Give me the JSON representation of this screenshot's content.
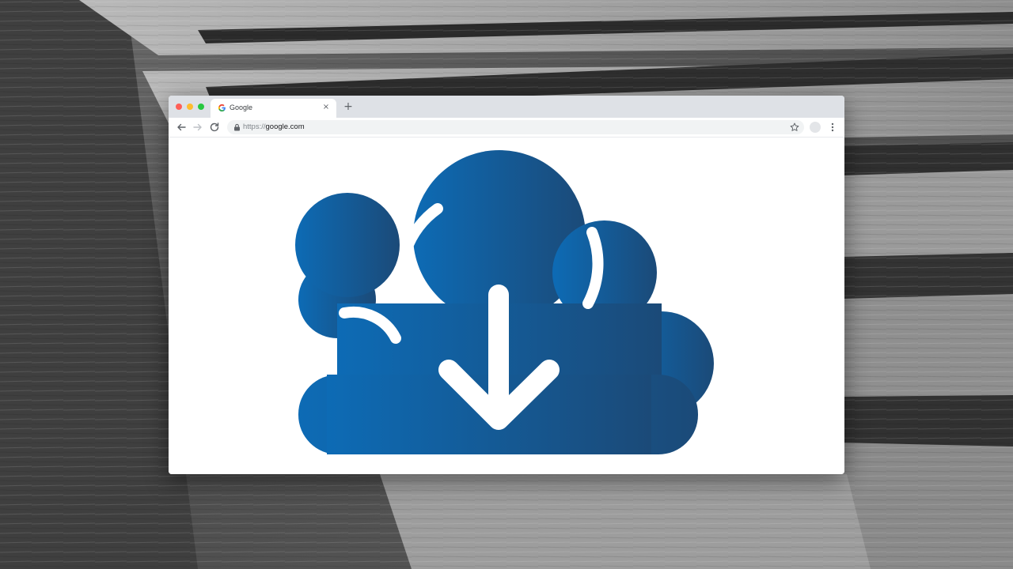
{
  "browser": {
    "tab": {
      "title": "Google",
      "favicon": "google-g-icon",
      "close_label": "×"
    },
    "new_tab_label": "+",
    "address_bar": {
      "scheme": "https://",
      "host": "google.com"
    }
  },
  "page": {
    "illustration": "cloud-download-icon"
  },
  "colors": {
    "cloud_gradient_start": "#0d6bb5",
    "cloud_gradient_end": "#1b4a78",
    "tab_strip": "#dee1e6",
    "omnibox": "#f1f3f4"
  }
}
